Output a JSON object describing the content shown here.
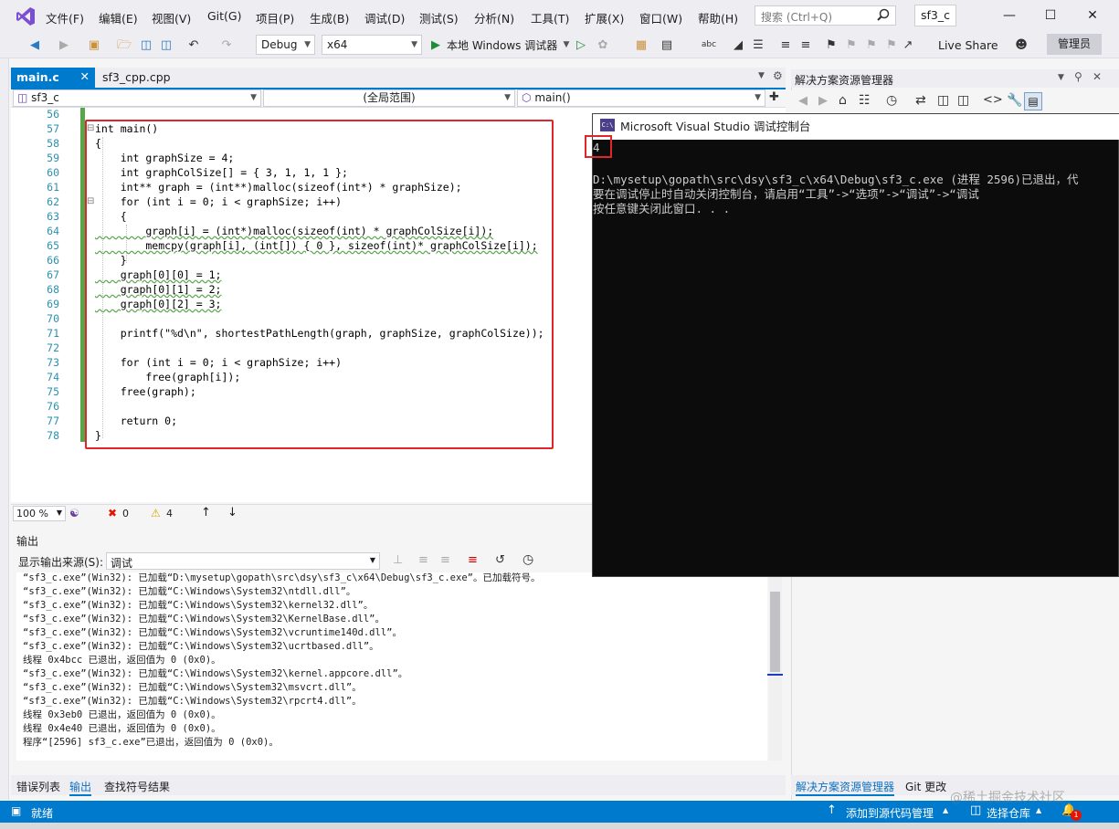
{
  "menubar": {
    "items": [
      "文件(F)",
      "编辑(E)",
      "视图(V)",
      "Git(G)",
      "项目(P)",
      "生成(B)",
      "调试(D)",
      "测试(S)",
      "分析(N)",
      "工具(T)",
      "扩展(X)",
      "窗口(W)",
      "帮助(H)"
    ],
    "search_placeholder": "搜索 (Ctrl+Q)",
    "solution_name": "sf3_c"
  },
  "toolbar": {
    "config": "Debug",
    "platform": "x64",
    "debugger": "本地 Windows 调试器",
    "live_share": "Live Share",
    "admin": "管理员"
  },
  "tabs": {
    "active": "main.c",
    "other": "sf3_cpp.cpp"
  },
  "navbar": {
    "project": "sf3_c",
    "scope": "(全局范围)",
    "member": "main()"
  },
  "editor": {
    "lines": [
      {
        "n": "56",
        "t": ""
      },
      {
        "n": "57",
        "t": "int main()"
      },
      {
        "n": "58",
        "t": "{"
      },
      {
        "n": "59",
        "t": "    int graphSize = 4;"
      },
      {
        "n": "60",
        "t": "    int graphColSize[] = { 3, 1, 1, 1 };"
      },
      {
        "n": "61",
        "t": "    int** graph = (int**)malloc(sizeof(int*) * graphSize);"
      },
      {
        "n": "62",
        "t": "    for (int i = 0; i < graphSize; i++)"
      },
      {
        "n": "63",
        "t": "    {"
      },
      {
        "n": "64",
        "t": "        graph[i] = (int*)malloc(sizeof(int) * graphColSize[i]);"
      },
      {
        "n": "65",
        "t": "        memcpy(graph[i], (int[]) { 0 }, sizeof(int)* graphColSize[i]);"
      },
      {
        "n": "66",
        "t": "    }"
      },
      {
        "n": "67",
        "t": "    graph[0][0] = 1;"
      },
      {
        "n": "68",
        "t": "    graph[0][1] = 2;"
      },
      {
        "n": "69",
        "t": "    graph[0][2] = 3;"
      },
      {
        "n": "70",
        "t": ""
      },
      {
        "n": "71",
        "t": "    printf(\"%d\\n\", shortestPathLength(graph, graphSize, graphColSize));"
      },
      {
        "n": "72",
        "t": ""
      },
      {
        "n": "73",
        "t": "    for (int i = 0; i < graphSize; i++)"
      },
      {
        "n": "74",
        "t": "        free(graph[i]);"
      },
      {
        "n": "75",
        "t": "    free(graph);"
      },
      {
        "n": "76",
        "t": ""
      },
      {
        "n": "77",
        "t": "    return 0;"
      },
      {
        "n": "78",
        "t": "}"
      }
    ],
    "zoom": "100 %",
    "errors": "0",
    "warnings": "4"
  },
  "output": {
    "title": "输出",
    "source_label": "显示输出来源(S):",
    "source_value": "调试",
    "lines": [
      "“sf3_c.exe”(Win32): 已加载“D:\\mysetup\\gopath\\src\\dsy\\sf3_c\\x64\\Debug\\sf3_c.exe”。已加载符号。",
      "“sf3_c.exe”(Win32): 已加载“C:\\Windows\\System32\\ntdll.dll”。",
      "“sf3_c.exe”(Win32): 已加载“C:\\Windows\\System32\\kernel32.dll”。",
      "“sf3_c.exe”(Win32): 已加载“C:\\Windows\\System32\\KernelBase.dll”。",
      "“sf3_c.exe”(Win32): 已加载“C:\\Windows\\System32\\vcruntime140d.dll”。",
      "“sf3_c.exe”(Win32): 已加载“C:\\Windows\\System32\\ucrtbased.dll”。",
      "线程 0x4bcc 已退出，返回值为 0 (0x0)。",
      "“sf3_c.exe”(Win32): 已加载“C:\\Windows\\System32\\kernel.appcore.dll”。",
      "“sf3_c.exe”(Win32): 已加载“C:\\Windows\\System32\\msvcrt.dll”。",
      "“sf3_c.exe”(Win32): 已加载“C:\\Windows\\System32\\rpcrt4.dll”。",
      "线程 0x3eb0 已退出，返回值为 0 (0x0)。",
      "线程 0x4e40 已退出，返回值为 0 (0x0)。",
      "程序“[2596] sf3_c.exe”已退出，返回值为 0 (0x0)。"
    ],
    "tabs": [
      "错误列表",
      "输出",
      "查找符号结果"
    ]
  },
  "solution_explorer": {
    "title": "解决方案资源管理器",
    "tabs": [
      "解决方案资源管理器",
      "Git 更改"
    ]
  },
  "console": {
    "title": "Microsoft Visual Studio 调试控制台",
    "icon_text": "C:\\",
    "lines": [
      "4",
      "",
      "D:\\mysetup\\gopath\\src\\dsy\\sf3_c\\x64\\Debug\\sf3_c.exe (进程 2596)已退出，代",
      "要在调试停止时自动关闭控制台，请启用“工具”->“选项”->“调试”->“调试",
      "按任意键关闭此窗口. . ."
    ]
  },
  "statusbar": {
    "ready": "就绪",
    "add_source": "添加到源代码管理",
    "select_repo": "选择仓库",
    "notifications": "1",
    "watermark": "@稀土掘金技术社区"
  },
  "colors": {
    "accent": "#007acc",
    "highlight": "#e0262b"
  }
}
